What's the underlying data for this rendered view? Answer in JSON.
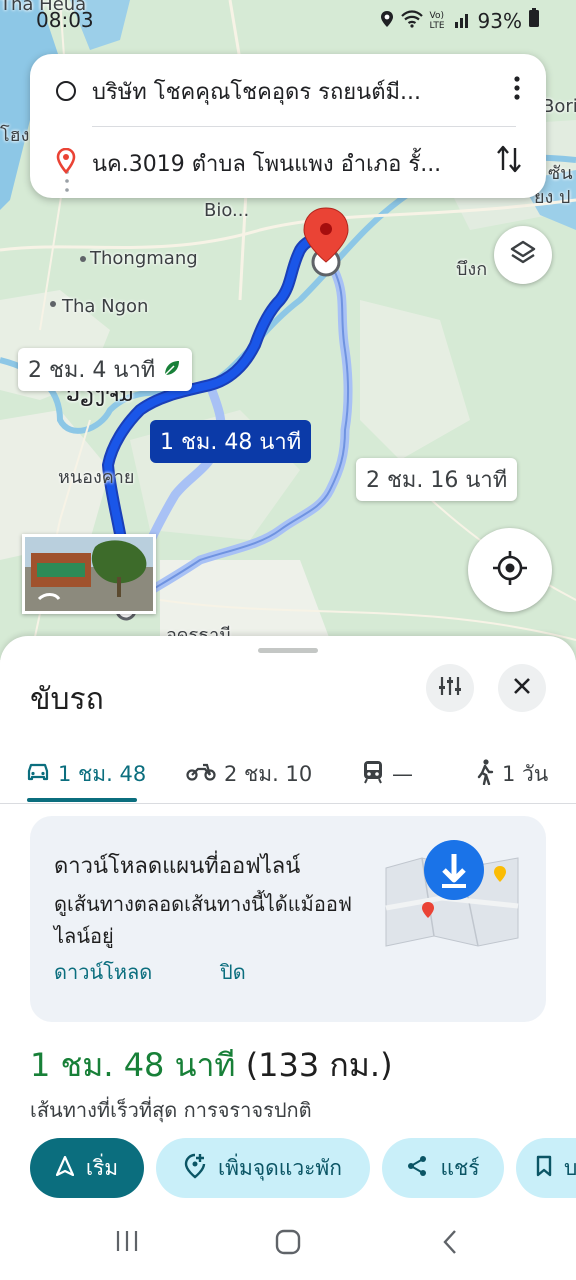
{
  "status_bar": {
    "time": "08:03",
    "battery": "93%",
    "net": "Vo) LTE"
  },
  "map": {
    "labels": {
      "tha_heua": "Tha Heua",
      "bio": "Bio...",
      "thongmang": "Thongmang",
      "tha_ngon": "Tha Ngon",
      "bori": "Bori",
      "buengkan": "บึงก",
      "vientiane": "ວຽງຈັນ",
      "nongkhai": "หนองคาย",
      "udon": "อุดรธานี",
      "laos_left": "โฮง",
      "laos_right1": "ซัน",
      "laos_right2": "ยง ป"
    },
    "times": {
      "eco": "2 ชม. 4 นาที",
      "fastest": "1 ชม. 48 นาที",
      "alt": "2 ชม. 16 นาที"
    },
    "colors": {
      "route_primary": "#1a56e8",
      "route_alt": "#a8c1f5",
      "pin": "#ea4335"
    }
  },
  "route": {
    "origin": "บริษัท โชคคุณโชคอุดร รถยนต์มี...",
    "destination": "นค.3019 ตำบล โพนแพง อำเภอ รั้..."
  },
  "sheet": {
    "title": "ขับรถ",
    "modes": [
      {
        "icon": "car-icon",
        "label": "1 ชม. 48"
      },
      {
        "icon": "motorcycle-icon",
        "label": "2 ชม. 10"
      },
      {
        "icon": "train-icon",
        "label": "—"
      },
      {
        "icon": "walk-icon",
        "label": "1 วัน"
      }
    ],
    "offline": {
      "title": "ดาวน์โหลดแผนที่ออฟไลน์",
      "desc": "ดูเส้นทางตลอดเส้นทางนี้ได้แม้ออฟไลน์อยู่",
      "download": "ดาวน์โหลด",
      "close": "ปิด"
    },
    "eta_time": "1 ชม. 48 นาที",
    "eta_distance": "(133 กม.)",
    "eta_sub": "เส้นทางที่เร็วที่สุด การจราจรปกติ",
    "actions": {
      "start": "เริ่ม",
      "add_stop": "เพิ่มจุดแวะพัก",
      "share": "แชร์",
      "save": "บ"
    },
    "accent": "#0b6e7e"
  }
}
